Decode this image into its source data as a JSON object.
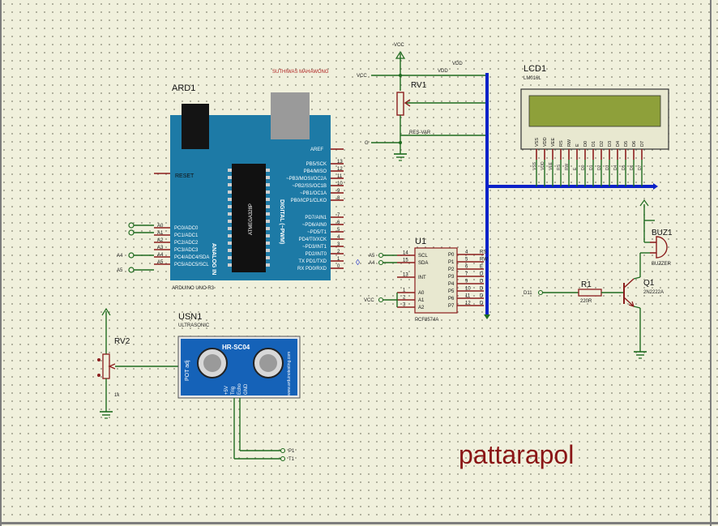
{
  "arduino": {
    "ref": "ARD1",
    "subtitle": "ARDUINO UNO R3",
    "top_note": "SUTHIWAS MAHAWONG",
    "reset": "RESET",
    "analog_in": "ANALOG IN",
    "digital": "DIGITAL (~PWM)",
    "chip": "ATMEGA328P",
    "aref": "AREF",
    "left_pins": [
      {
        "num": "A0",
        "name": "PC0/ADC0"
      },
      {
        "num": "A1",
        "name": "PC1/ADC1"
      },
      {
        "num": "A2",
        "name": "PC2/ADC2"
      },
      {
        "num": "A3",
        "name": "PC3/ADC3"
      },
      {
        "num": "A4",
        "name": "PC4/ADC4/SDA"
      },
      {
        "num": "A5",
        "name": "PC5/ADC5/SCL"
      }
    ],
    "right_pins_top": [
      {
        "num": "13",
        "name": "PB5/SCK"
      },
      {
        "num": "12",
        "name": "PB4/MISO"
      },
      {
        "num": "11",
        "name": "~PB3/MOSI/OC2A"
      },
      {
        "num": "10",
        "name": "~PB2/SS/OC1B"
      },
      {
        "num": "9",
        "name": "~PB1/OC1A"
      },
      {
        "num": "8",
        "name": "PB0/ICP1/CLKO"
      }
    ],
    "right_pins_bottom": [
      {
        "num": "7",
        "name": "PD7/AIN1"
      },
      {
        "num": "6",
        "name": "~PD6/AIN0"
      },
      {
        "num": "5",
        "name": "~PD5/T1"
      },
      {
        "num": "4",
        "name": "PD4/T0/XCK"
      },
      {
        "num": "3",
        "name": "~PD3/INT1"
      },
      {
        "num": "2",
        "name": "PD2/INT0"
      },
      {
        "num": "1",
        "name": "TX PD1/TXD"
      },
      {
        "num": "0",
        "name": "RX PD0/RXD"
      }
    ],
    "net_a4": "A4",
    "net_a5": "A5"
  },
  "power": {
    "vcc_top": "VCC",
    "vcc_left": "VCC",
    "vdd": "VDD",
    "vdd_wire": "VDD",
    "g_label": "G",
    "vee_wire": "RES-VAR"
  },
  "rv1": {
    "ref": "RV1"
  },
  "lcd": {
    "ref": "LCD1",
    "model": "LM016L",
    "pins": [
      "VSS",
      "VDD",
      "VEE",
      "RS",
      "RW",
      "E",
      "D0",
      "D1",
      "D2",
      "D3",
      "D4",
      "D5",
      "D6",
      "D7"
    ],
    "screen_color": "#8ea03a"
  },
  "u1": {
    "ref": "U1",
    "model": "PCF8574A",
    "left_pins": [
      {
        "num": "14",
        "name": "SCL"
      },
      {
        "num": "15",
        "name": "SDA"
      },
      {
        "num": "13",
        "name": "INT"
      },
      {
        "num": "1",
        "name": "A0"
      },
      {
        "num": "2",
        "name": "A1"
      },
      {
        "num": "3",
        "name": "A2"
      }
    ],
    "right_pins": [
      {
        "num": "4",
        "name": "P0",
        "net": "RS"
      },
      {
        "num": "5",
        "name": "P1",
        "net": "RW"
      },
      {
        "num": "6",
        "name": "P2",
        "net": "E"
      },
      {
        "num": "7",
        "name": "P3",
        "net": "D"
      },
      {
        "num": "9",
        "name": "P4",
        "net": "D"
      },
      {
        "num": "10",
        "name": "P5",
        "net": "D"
      },
      {
        "num": "11",
        "name": "P6",
        "net": "D"
      },
      {
        "num": "12",
        "name": "P7",
        "net": "D"
      }
    ],
    "net_a5": "A5",
    "net_a4": "A4",
    "net_vcc": "VCC"
  },
  "buzzer": {
    "ref": "BUZ1",
    "model": "BUZZER"
  },
  "transistor": {
    "ref": "Q1",
    "model": "2N2222A"
  },
  "r1": {
    "ref": "R1",
    "value": "220R",
    "net_in": "D11"
  },
  "rv2": {
    "ref": "RV2",
    "value": "1k"
  },
  "usn": {
    "ref": "USN1",
    "desc": "ULTRASONIC",
    "title": "HR-SC04",
    "pot": "POT adj",
    "website": "www.arduinotesting.com",
    "pins": [
      "+5V",
      "Trig",
      "Echo",
      "GND"
    ],
    "board_color": "#1562b8",
    "net_p1": "P1",
    "net_t1": "T1"
  },
  "author": {
    "text": "pattarapol",
    "color": "#8a1616"
  }
}
